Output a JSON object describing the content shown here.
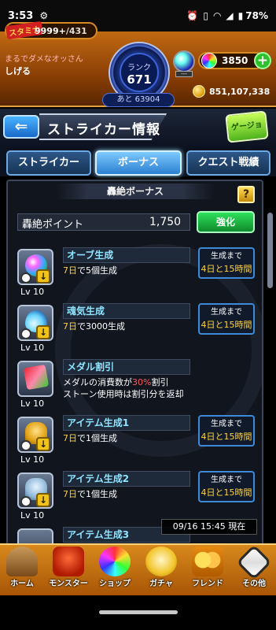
{
  "status_bar": {
    "time": "3:53",
    "battery": "78%"
  },
  "header": {
    "stamina_tag": "スタミナ",
    "stamina_current": "9999+",
    "stamina_max": "/431",
    "username_line1": "まるでダメなオッさん",
    "username_line2": "しげる",
    "rank_label": "ランク",
    "rank_value": "671",
    "rank_next": "あと 63904",
    "orb_sub": "---",
    "orb_count": "3850",
    "plus": "+",
    "coins": "851,107,338"
  },
  "titlebar": {
    "back": "⇐",
    "title": "ストライカー情報",
    "guide": "ゲージョン"
  },
  "tabs": [
    {
      "label": "ストライカー"
    },
    {
      "label": "ボーナス"
    },
    {
      "label": "クエスト戦績"
    }
  ],
  "section": {
    "title": "轟絶ボーナス",
    "help": "?",
    "points_label": "轟絶ポイント",
    "points_value": "1,750",
    "enhance": "強化"
  },
  "bonuses": [
    {
      "name": "オーブ生成",
      "lv": "Lv 10",
      "desc_days": "7日",
      "desc_rest": "で5個生成",
      "time_label": "生成まで",
      "time_value": "4日と15時間"
    },
    {
      "name": "魂気生成",
      "lv": "Lv 10",
      "desc_days": "7日",
      "desc_rest": "で3000生成",
      "time_label": "生成まで",
      "time_value": "4日と15時間"
    },
    {
      "name": "メダル割引",
      "lv": "Lv 10",
      "desc_a": "メダルの消費数が",
      "desc_pct": "30%",
      "desc_b": "割引",
      "desc_line2": "ストーン使用時は割引分を返却"
    },
    {
      "name": "アイテム生成1",
      "lv": "Lv 10",
      "desc_days": "7日",
      "desc_rest": "で1個生成",
      "time_label": "生成まで",
      "time_value": "4日と15時間"
    },
    {
      "name": "アイテム生成2",
      "lv": "Lv 10",
      "desc_days": "7日",
      "desc_rest": "で1個生成",
      "time_label": "生成まで",
      "time_value": "4日と15時間"
    },
    {
      "name": "アイテム生成3"
    }
  ],
  "timestamp": "09/16 15:45 現在",
  "bottom_nav": [
    {
      "label": "ホーム"
    },
    {
      "label": "モンスター"
    },
    {
      "label": "ショップ"
    },
    {
      "label": "ガチャ"
    },
    {
      "label": "フレンド"
    },
    {
      "label": "その他"
    }
  ],
  "colors": {
    "accent_gold": "#ffd23a",
    "name_cyan": "#8fe4ff",
    "enhance_green": "#1fb84a"
  }
}
